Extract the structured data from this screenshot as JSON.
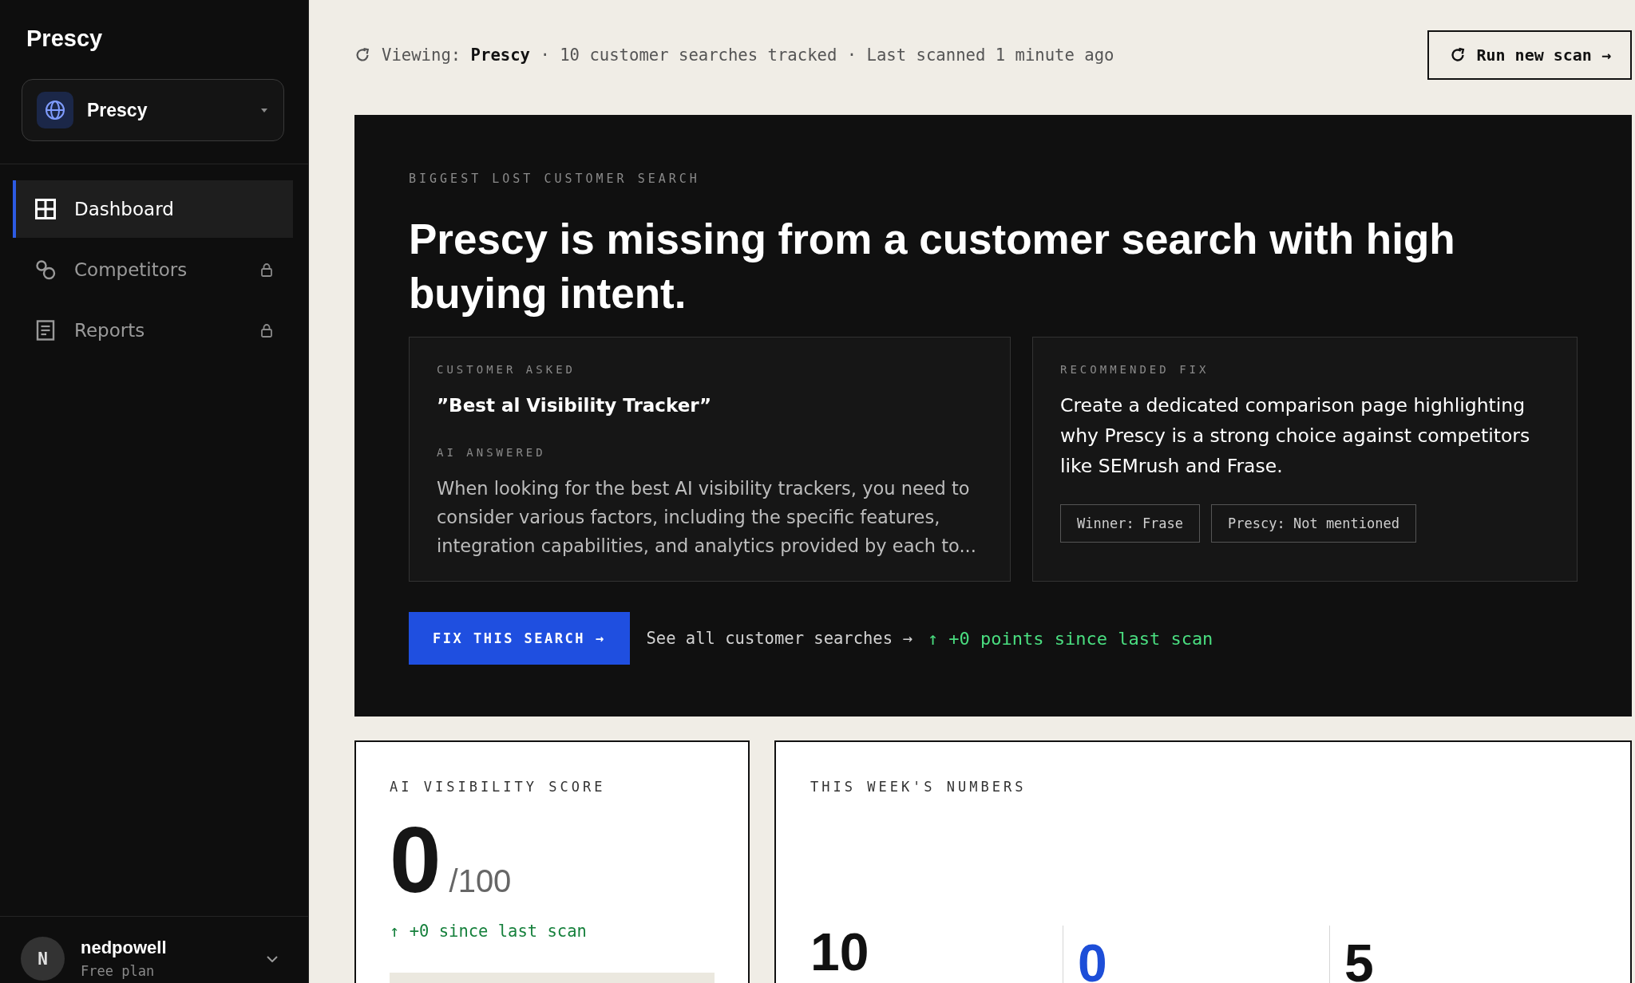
{
  "sidebar": {
    "brand": "Prescy",
    "workspace": {
      "name": "Prescy"
    },
    "nav": [
      {
        "label": "Dashboard",
        "selected": true,
        "locked": false
      },
      {
        "label": "Competitors",
        "selected": false,
        "locked": true
      },
      {
        "label": "Reports",
        "selected": false,
        "locked": true
      }
    ],
    "user": {
      "initial": "N",
      "name": "nedpowell",
      "plan": "Free plan"
    }
  },
  "top_bar": {
    "status": "Viewing: **Prescy** · 10 customer searches tracked · Last scanned 1 minute ago",
    "button": "Run new scan →"
  },
  "hero": {
    "eyebrow": "BIGGEST LOST CUSTOMER SEARCH",
    "headline": "Prescy is missing from a customer search with high buying intent.",
    "customer_asked": {
      "label": "CUSTOMER ASKED",
      "query": "”Best al Visibility Tracker”"
    },
    "ai_answered": {
      "label": "AI ANSWERED",
      "text": "When looking for the best AI visibility trackers, you need to consider various factors, including the specific features, integration capabilities, and analytics provided by each to..."
    },
    "recommended_fix": {
      "label": "RECOMMENDED FIX",
      "text": "Create a dedicated comparison page highlighting why Prescy is a strong choice against competitors like SEMrush and Frase.",
      "tags": [
        "Winner: Frase",
        "Prescy: Not mentioned"
      ]
    },
    "primary_button": "FIX THIS SEARCH →",
    "link": "See all customer searches →",
    "change": "↑ +0 points since last scan"
  },
  "score_card": {
    "label": "AI VISIBILITY SCORE",
    "score": "0",
    "max": "/100",
    "change": "↑ +0 since last scan"
  },
  "weekly_numbers": {
    "label": "THIS WEEK'S NUMBERS",
    "stats": [
      {
        "value": "10",
        "color": "#111111"
      },
      {
        "value": "0",
        "color": "#1d4ed8"
      },
      {
        "value": "5",
        "color": "#111111"
      }
    ]
  }
}
